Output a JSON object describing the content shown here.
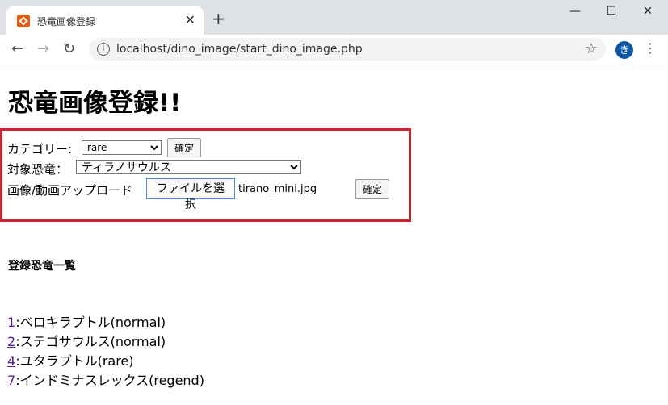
{
  "browser": {
    "tab_title": "恐竜画像登録",
    "new_tab_label": "+",
    "close_tab_label": "✕",
    "window_controls": {
      "minimize": "—",
      "maximize": "☐",
      "close": "✕"
    },
    "url": "localhost/dino_image/start_dino_image.php",
    "profile_initial": "き"
  },
  "page": {
    "heading": "恐竜画像登録!!",
    "form": {
      "category_label": "カテゴリー:",
      "category_value": "rare",
      "category_confirm": "確定",
      "target_label": "対象恐竜：",
      "target_value": "ティラノサウルス",
      "upload_label": "画像/動画アップロード",
      "file_button": "ファイルを選択",
      "file_name": "tirano_mini.jpg",
      "upload_confirm": "確定"
    },
    "list_title": "登録恐竜一覧",
    "list": [
      {
        "id": "1",
        "text": ":ベロキラプトル(normal)"
      },
      {
        "id": "2",
        "text": ":ステゴサウルス(normal)"
      },
      {
        "id": "4",
        "text": ":ユタラプトル(rare)"
      },
      {
        "id": "7",
        "text": ":インドミナスレックス(regend)"
      }
    ]
  }
}
